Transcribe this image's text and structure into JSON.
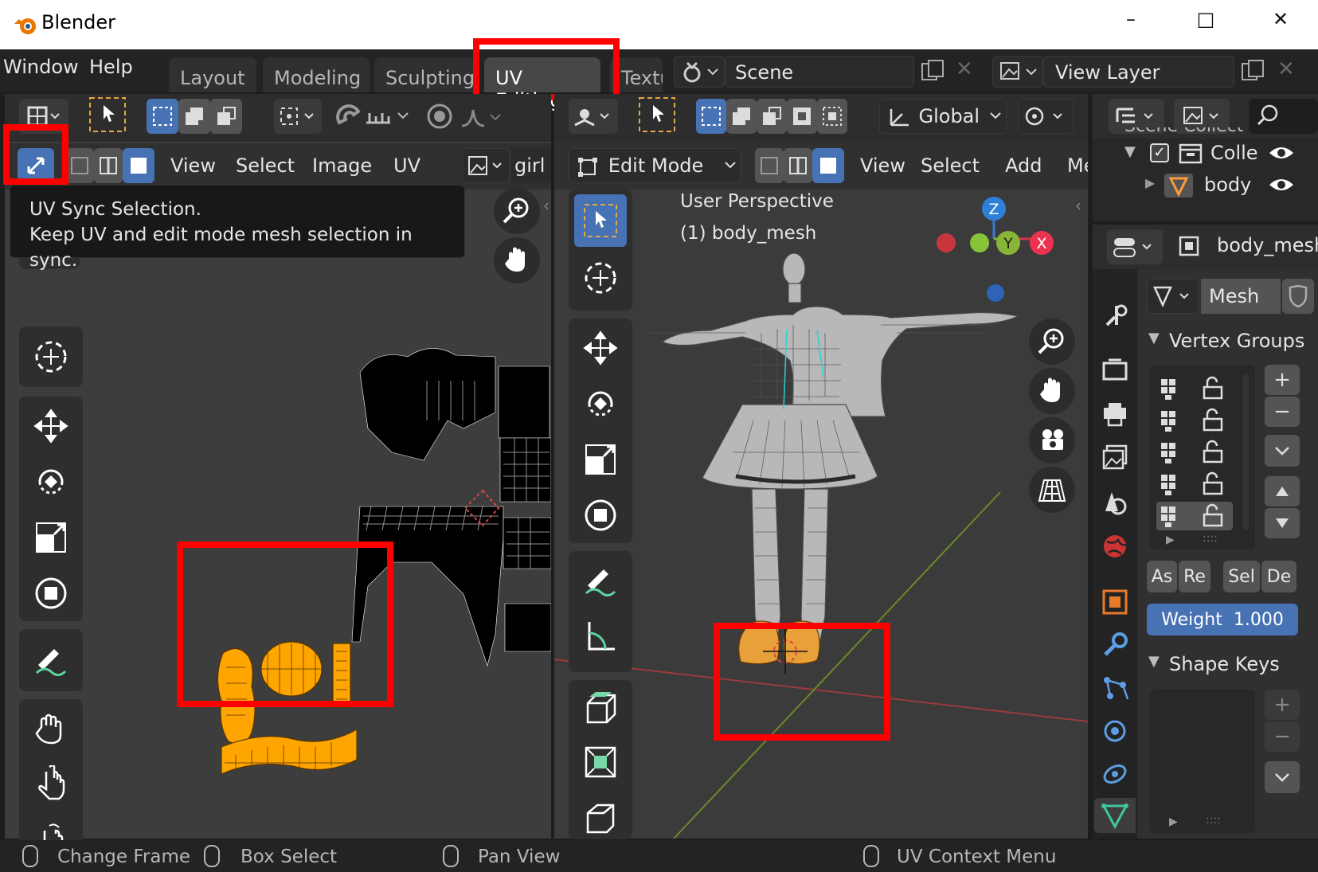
{
  "window": {
    "title": "Blender",
    "minimize": "–",
    "maximize": "□",
    "close": "✕"
  },
  "menu": {
    "window": "Window",
    "help": "Help"
  },
  "workspaces": [
    "Layout",
    "Modeling",
    "Sculpting",
    "UV Editing",
    "Textu"
  ],
  "scene": {
    "name": "Scene",
    "view_layer": "View Layer"
  },
  "uv_editor": {
    "menus": [
      "View",
      "Select",
      "Image",
      "UV"
    ],
    "image_name": "girl",
    "tooltip_title": "UV Sync Selection.",
    "tooltip_desc": "Keep UV and edit mode mesh selection in sync."
  },
  "viewport": {
    "transform_orientation": "Global",
    "mode": "Edit Mode",
    "menus": [
      "View",
      "Select",
      "Add",
      "Me"
    ],
    "overlay_line1": "User Perspective",
    "overlay_line2": "(1) body_mesh",
    "gizmo": {
      "z": "Z",
      "y": "Y",
      "x": "X"
    }
  },
  "outliner": {
    "scene_collection": "Scene Collect",
    "collection": "Colle",
    "object": "body"
  },
  "properties": {
    "object_name": "body_mesh",
    "data_name": "Mesh",
    "vertex_groups_header": "Vertex Groups",
    "vg_buttons": [
      "As",
      "Re",
      "Sel",
      "De"
    ],
    "weight_label": "Weight",
    "weight_value": "1.000",
    "shape_keys_header": "Shape Keys"
  },
  "statusbar": [
    "Change Frame",
    "Box Select",
    "Pan View",
    "UV Context Menu"
  ],
  "colors": {
    "accent": "#4772b3",
    "highlight": "#ff0000",
    "selected_uv": "#ffa500"
  }
}
